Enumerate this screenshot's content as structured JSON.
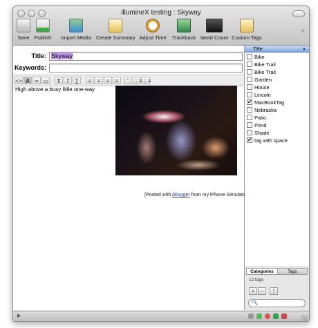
{
  "window": {
    "title": "illumineX testing : Skyway"
  },
  "toolbar": {
    "items": [
      {
        "label": "Save",
        "icon": "save-icon"
      },
      {
        "label": "Publish",
        "icon": "publish-icon"
      },
      {
        "label": "Import Media",
        "icon": "import-media-icon"
      },
      {
        "label": "Create Summary",
        "icon": "create-summary-icon"
      },
      {
        "label": "Adjust Time",
        "icon": "adjust-time-icon"
      },
      {
        "label": "Trackback",
        "icon": "trackback-icon"
      },
      {
        "label": "Word Count",
        "icon": "word-count-icon"
      },
      {
        "label": "Custom Tags",
        "icon": "custom-tags-icon"
      }
    ],
    "overflow_glyph": "»"
  },
  "editor": {
    "title_label": "Title:",
    "title_value": "Skyway",
    "keywords_label": "Keywords:",
    "keywords_value": "",
    "format_buttons": [
      "<>",
      "A",
      "∞",
      "▭",
      "T",
      "T",
      "T",
      "≡",
      "≡",
      "≡",
      "≡",
      "”",
      "⋮≡",
      "⋮≡"
    ],
    "body_text": "High above a busy little one-way",
    "posted_prefix": "[Posted with ",
    "posted_link": "iBlogger",
    "posted_suffix": " from my iPhone Simulator]"
  },
  "sidebar": {
    "column_header": "Title",
    "sort_glyph": "▲",
    "tags": [
      {
        "name": "Bike",
        "checked": false
      },
      {
        "name": "Bike Trail",
        "checked": false
      },
      {
        "name": "Bike Trail",
        "checked": false
      },
      {
        "name": "Garden",
        "checked": false
      },
      {
        "name": "House",
        "checked": false
      },
      {
        "name": "Lincoln",
        "checked": false
      },
      {
        "name": "MacBookTag",
        "checked": true
      },
      {
        "name": "Nebraska",
        "checked": false
      },
      {
        "name": "Patio",
        "checked": false
      },
      {
        "name": "Pond",
        "checked": false
      },
      {
        "name": "Shade",
        "checked": false
      },
      {
        "name": "tag with space",
        "checked": true
      }
    ],
    "tab_categories": "Categories",
    "tab_tags": "Tags",
    "tag_count": "12 tags",
    "add_label": "+",
    "remove_label": "−",
    "info_label": "!",
    "search_placeholder": "",
    "search_glyph": "🔍"
  },
  "statusbar": {
    "left_glyph": "▶"
  },
  "colors": {
    "accent_blue": "#7fa5dd",
    "title_highlight": "#c9a0f0"
  }
}
